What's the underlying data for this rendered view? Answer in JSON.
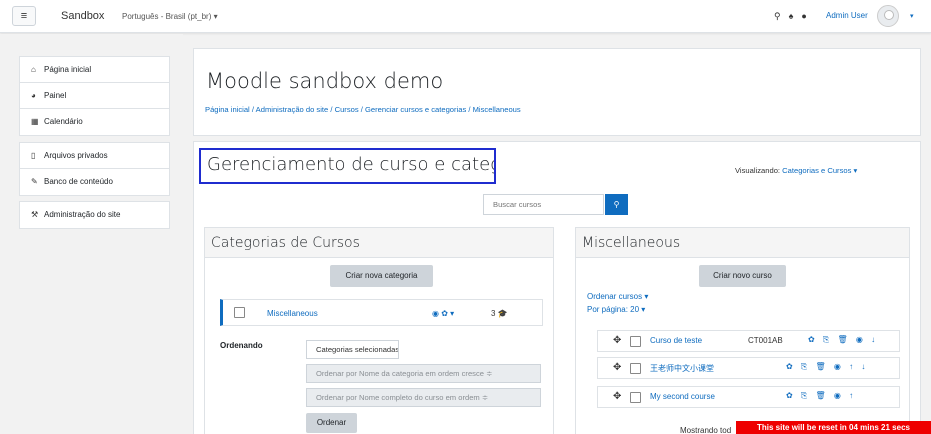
{
  "navbar": {
    "menu_icon": "hamburger-icon",
    "brand": "Sandbox",
    "language": "Português - Brasil (pt_br) ▾",
    "user_name": "Admin User",
    "caret": "▾"
  },
  "sidebar": {
    "groups": [
      [
        {
          "label": "Página inicial",
          "icon": "home-icon"
        },
        {
          "label": "Painel",
          "icon": "dashboard-icon"
        },
        {
          "label": "Calendário",
          "icon": "calendar-icon"
        }
      ],
      [
        {
          "label": "Arquivos privados",
          "icon": "file-icon"
        },
        {
          "label": "Banco de conteúdo",
          "icon": "pencil-icon"
        }
      ],
      [
        {
          "label": "Administração do site",
          "icon": "wrench-icon"
        }
      ]
    ]
  },
  "header": {
    "site_title": "Moodle sandbox demo",
    "breadcrumb": "Página inicial / Administração do site / Cursos / Gerenciar cursos e categorias / Miscellaneous"
  },
  "management": {
    "title": "Gerenciamento de curso e categoria",
    "viewing_label": "Visualizando:",
    "viewing_value": "Categorias e Cursos ▾",
    "search_placeholder": "Buscar cursos"
  },
  "categories_panel": {
    "title": "Categorias de Cursos",
    "create_button": "Criar nova categoria",
    "category": {
      "name": "Miscellaneous",
      "actions": "◉ ✿ ▾",
      "count": "3"
    },
    "ordering_label": "Ordenando",
    "selects": [
      "Categorias selecionadas ≑",
      "Ordenar por Nome da categoria em ordem cresce ≑",
      "Ordenar por Nome completo do curso em ordem ≑"
    ],
    "order_button": "Ordenar"
  },
  "courses_panel": {
    "title": "Miscellaneous",
    "create_button": "Criar novo curso",
    "sort_link": "Ordenar cursos ▾",
    "per_page_link": "Por página: 20 ▾",
    "courses": [
      {
        "name": "Curso de teste",
        "code": "CT001AB",
        "actions": "✿ ⎘ 🗑 ◉ ↓"
      },
      {
        "name": "王老师中文小课堂",
        "code": "",
        "actions": "✿ ⎘ 🗑 ◉ ↑ ↓"
      },
      {
        "name": "My second course",
        "code": "",
        "actions": "✿ ⎘ 🗑 ◉ ↑"
      }
    ],
    "showing": "Mostrando tod"
  },
  "banner": "This site will be reset in 04 mins 21 secs",
  "colors": {
    "accent": "#0f6cbf",
    "highlight_border": "#1f2ccf",
    "banner": "#ee0000"
  }
}
